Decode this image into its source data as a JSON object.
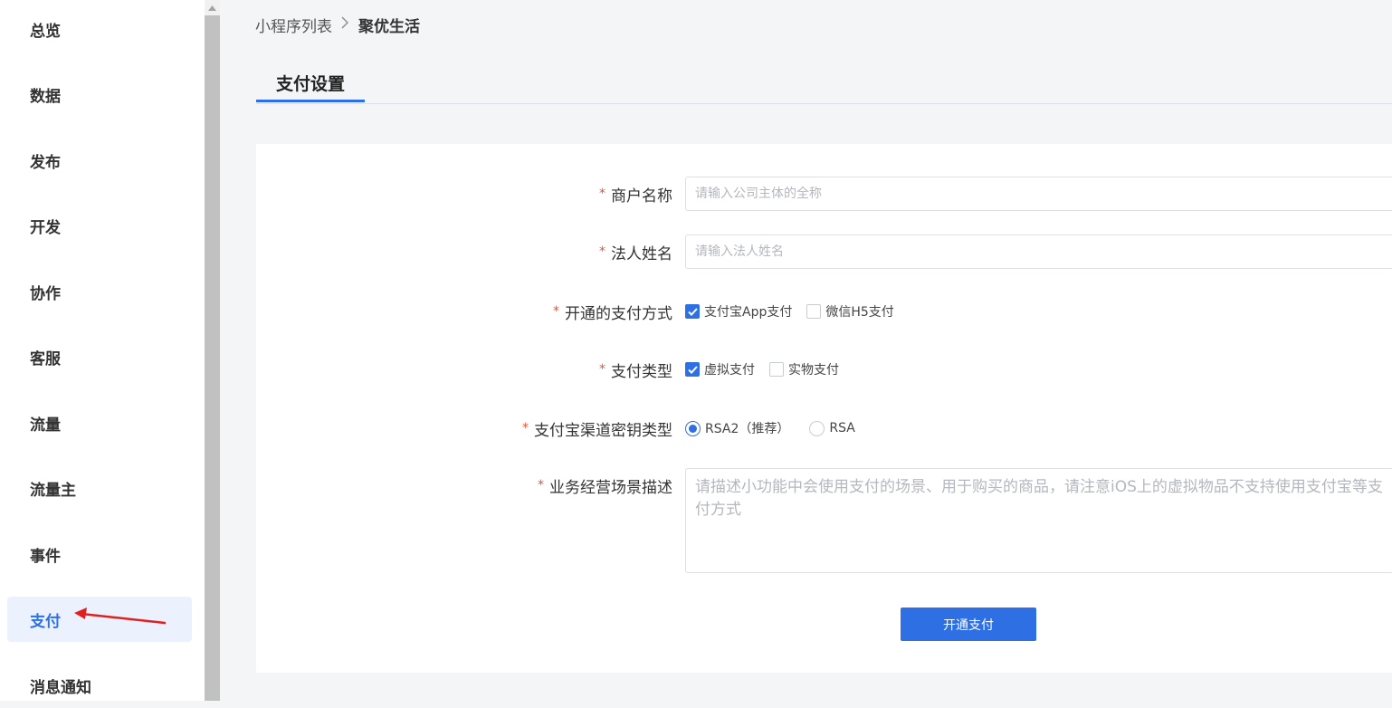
{
  "sidebar": {
    "items": [
      {
        "label": "总览"
      },
      {
        "label": "数据"
      },
      {
        "label": "发布"
      },
      {
        "label": "开发"
      },
      {
        "label": "协作"
      },
      {
        "label": "客服"
      },
      {
        "label": "流量"
      },
      {
        "label": "流量主"
      },
      {
        "label": "事件"
      },
      {
        "label": "支付",
        "active": true
      },
      {
        "label": "消息通知"
      }
    ]
  },
  "breadcrumb": {
    "parent": "小程序列表",
    "current": "聚优生活"
  },
  "tabs": [
    {
      "label": "支付设置",
      "active": true
    }
  ],
  "form": {
    "merchant_name": {
      "label": "商户名称",
      "value": "",
      "placeholder": "请输入公司主体的全称"
    },
    "legal_name": {
      "label": "法人姓名",
      "value": "",
      "placeholder": "请输入法人姓名"
    },
    "payment_methods": {
      "label": "开通的支付方式",
      "options": [
        {
          "label": "支付宝App支付",
          "checked": true
        },
        {
          "label": "微信H5支付",
          "checked": false
        }
      ]
    },
    "payment_type": {
      "label": "支付类型",
      "options": [
        {
          "label": "虚拟支付",
          "checked": true
        },
        {
          "label": "实物支付",
          "checked": false
        }
      ]
    },
    "key_type": {
      "label": "支付宝渠道密钥类型",
      "options": [
        {
          "label": "RSA2（推荐）",
          "selected": true
        },
        {
          "label": "RSA",
          "selected": false
        }
      ]
    },
    "business_desc": {
      "label": "业务经营场景描述",
      "value": "",
      "placeholder": "请描述小功能中会使用支付的场景、用于购买的商品，请注意iOS上的虚拟物品不支持使用支付宝等支付方式"
    },
    "submit_label": "开通支付"
  },
  "colors": {
    "accent": "#2f6fe4",
    "required": "#e5533d",
    "annotation_arrow": "#e02020"
  },
  "icons": {
    "breadcrumb_separator": "chevron-right-icon",
    "checkbox_checked": "check-icon",
    "scroll_up": "triangle-up-icon"
  }
}
